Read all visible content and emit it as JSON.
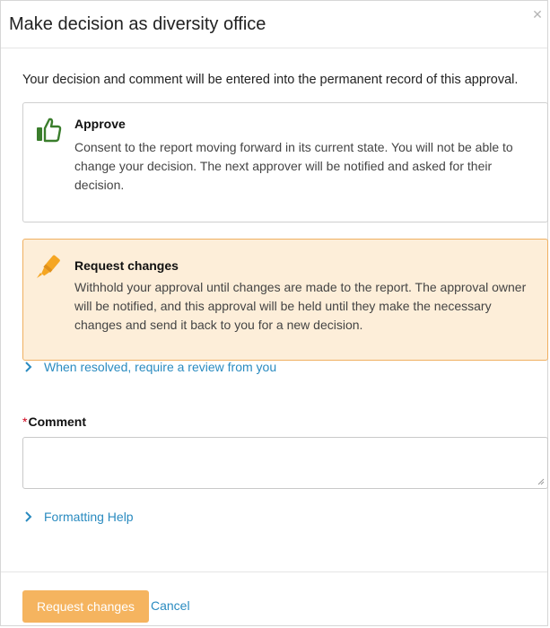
{
  "dialog": {
    "title": "Make decision as diversity office",
    "close_icon": "close-icon",
    "intro": "Your decision and comment will be entered into the permanent record of this approval."
  },
  "options": {
    "approve": {
      "icon": "thumbs-up-icon",
      "title": "Approve",
      "description": "Consent to the report moving forward in its current state. You will not be able to change your decision. The next approver will be notified and asked for their decision."
    },
    "request_changes": {
      "icon": "highlighter-icon",
      "title": "Request changes",
      "description": "Withhold your approval until changes are made to the report. The approval owner will be notified, and this approval will be held until they make the necessary changes and send it back to you for a new decision.",
      "selected": true
    }
  },
  "review_toggle": {
    "label": "When resolved, require a review from you"
  },
  "comment": {
    "required_mark": "*",
    "label": "Comment",
    "value": ""
  },
  "formatting_help": {
    "label": "Formatting Help"
  },
  "footer": {
    "submit_label": "Request changes",
    "cancel_label": "Cancel"
  },
  "colors": {
    "accent_link": "#2a8bc0",
    "approve_icon": "#3a7d2c",
    "selected_bg": "#fdeed9",
    "selected_border": "#f0b061",
    "primary_button": "#f5b45f"
  }
}
